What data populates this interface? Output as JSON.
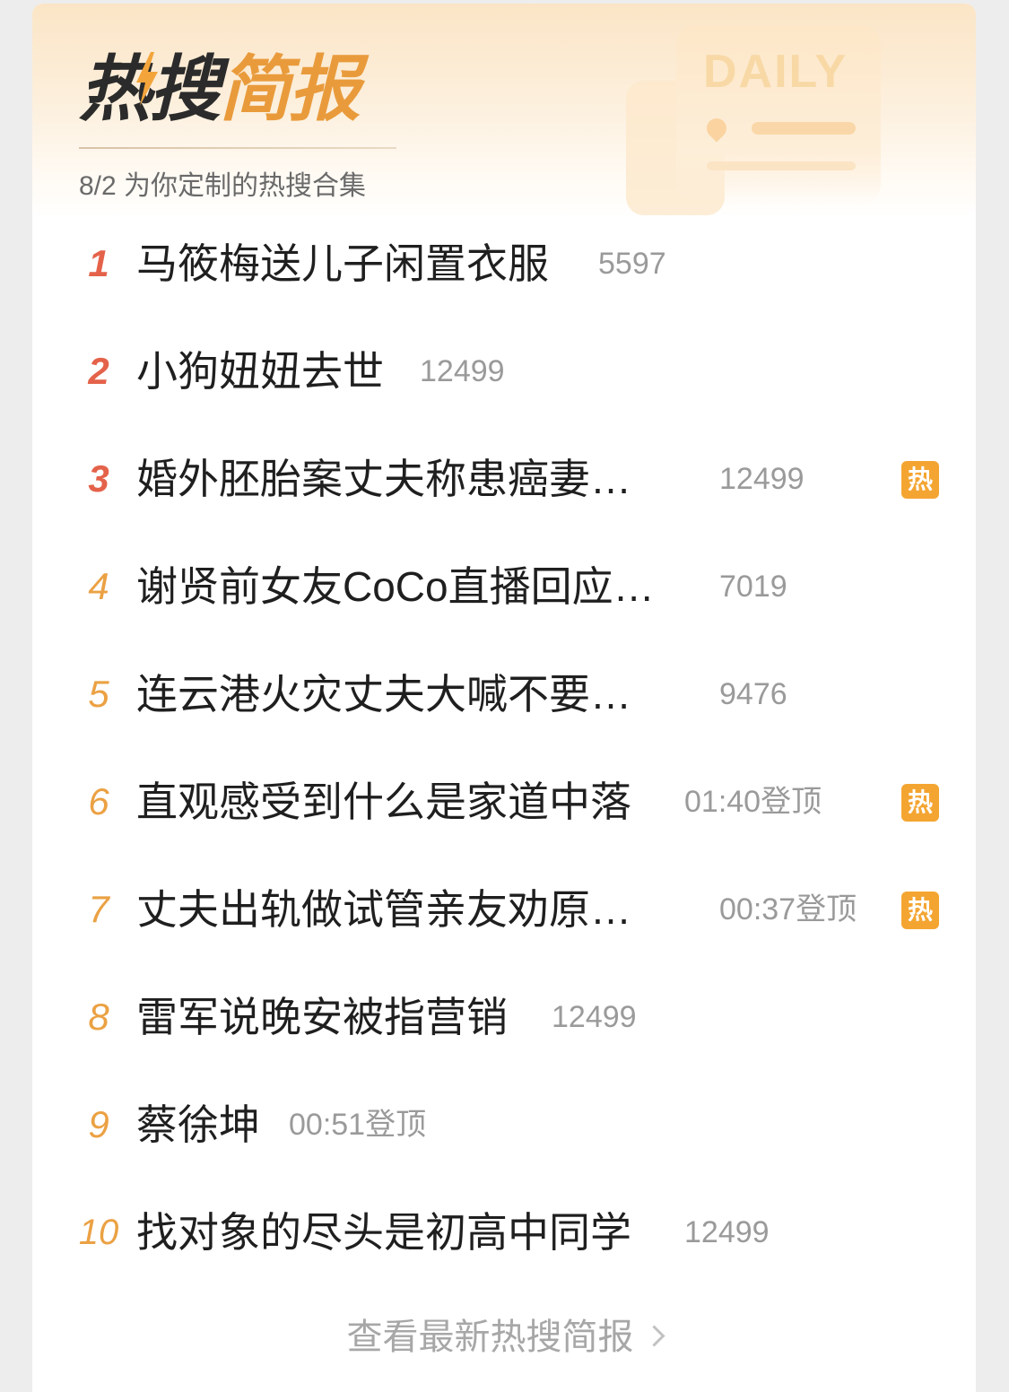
{
  "header": {
    "title_part1": "热搜",
    "title_part2": "简报",
    "daily_label": "DAILY",
    "subtitle": "8/2 为你定制的热搜合集"
  },
  "colors": {
    "rank_top": "#e4624a",
    "rank_other": "#eba143",
    "hot_badge": "#f4a531",
    "title_accent": "#e99b3c"
  },
  "items": [
    {
      "rank": "1",
      "title": "马筱梅送儿子闲置衣服",
      "meta": "5597",
      "hot": ""
    },
    {
      "rank": "2",
      "title": "小狗妞妞去世",
      "meta": "12499",
      "hot": ""
    },
    {
      "rank": "3",
      "title": "婚外胚胎案丈夫称患癌妻…",
      "meta": "12499",
      "hot": "热"
    },
    {
      "rank": "4",
      "title": "谢贤前女友CoCo直播回应…",
      "meta": "7019",
      "hot": ""
    },
    {
      "rank": "5",
      "title": "连云港火灾丈夫大喊不要…",
      "meta": "9476",
      "hot": ""
    },
    {
      "rank": "6",
      "title": "直观感受到什么是家道中落",
      "meta": "01:40登顶",
      "hot": "热"
    },
    {
      "rank": "7",
      "title": "丈夫出轨做试管亲友劝原…",
      "meta": "00:37登顶",
      "hot": "热"
    },
    {
      "rank": "8",
      "title": "雷军说晚安被指营销",
      "meta": "12499",
      "hot": ""
    },
    {
      "rank": "9",
      "title": "蔡徐坤",
      "meta": "00:51登顶",
      "hot": ""
    },
    {
      "rank": "10",
      "title": "找对象的尽头是初高中同学",
      "meta": "12499",
      "hot": ""
    }
  ],
  "footer": {
    "link_label": "查看最新热搜简报"
  }
}
